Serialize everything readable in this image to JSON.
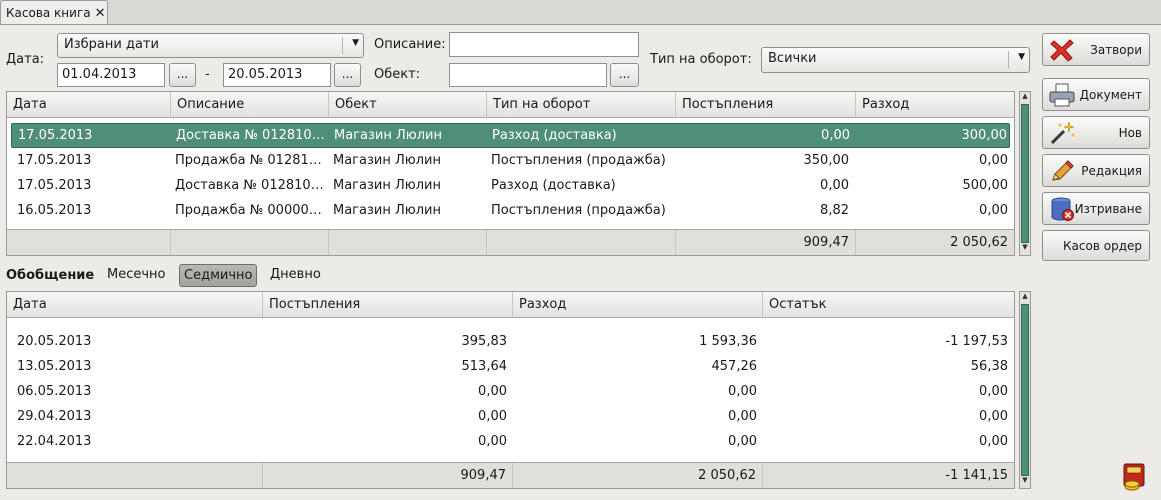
{
  "tab": {
    "title": "Касова книга",
    "close_glyph": "✕"
  },
  "filters": {
    "date_label": "Дата:",
    "date_mode": "Избрани дати",
    "date_from": "01.04.2013",
    "date_to": "20.05.2013",
    "dash": "-",
    "ellipsis": "...",
    "description_label": "Описание:",
    "description_value": "",
    "object_label": "Обект:",
    "object_value": "",
    "turnover_label": "Тип на оборот:",
    "turnover_value": "Всички"
  },
  "main_table": {
    "columns": [
      "Дата",
      "Описание",
      "Обект",
      "Тип на оборот",
      "Постъпления",
      "Разход"
    ],
    "rows": [
      {
        "date": "17.05.2013",
        "description": "Доставка № 012810…",
        "object": "Магазин Люлин",
        "type": "Разход (доставка)",
        "income": "0,00",
        "expense": "300,00"
      },
      {
        "date": "17.05.2013",
        "description": "Продажба № 01281…",
        "object": "Магазин Люлин",
        "type": "Постъпления (продажба)",
        "income": "350,00",
        "expense": "0,00"
      },
      {
        "date": "17.05.2013",
        "description": "Доставка № 012810…",
        "object": "Магазин Люлин",
        "type": "Разход (доставка)",
        "income": "0,00",
        "expense": "500,00"
      },
      {
        "date": "16.05.2013",
        "description": "Продажба № 00000…",
        "object": "Магазин Люлин",
        "type": "Постъпления (продажба)",
        "income": "8,82",
        "expense": "0,00"
      }
    ],
    "totals": {
      "income": "909,47",
      "expense": "2 050,62"
    }
  },
  "summary": {
    "title": "Обобщение",
    "modes": [
      "Месечно",
      "Седмично",
      "Дневно"
    ],
    "active_mode": "Седмично",
    "columns": [
      "Дата",
      "Постъпления",
      "Разход",
      "Остатък"
    ],
    "rows": [
      {
        "date": "20.05.2013",
        "income": "395,83",
        "expense": "1 593,36",
        "balance": "-1 197,53"
      },
      {
        "date": "13.05.2013",
        "income": "513,64",
        "expense": "457,26",
        "balance": "56,38"
      },
      {
        "date": "06.05.2013",
        "income": "0,00",
        "expense": "0,00",
        "balance": "0,00"
      },
      {
        "date": "29.04.2013",
        "income": "0,00",
        "expense": "0,00",
        "balance": "0,00"
      },
      {
        "date": "22.04.2013",
        "income": "0,00",
        "expense": "0,00",
        "balance": "0,00"
      }
    ],
    "totals": {
      "income": "909,47",
      "expense": "2 050,62",
      "balance": "-1 141,15"
    }
  },
  "actions": {
    "close": "Затвори",
    "document": "Документ",
    "new": "Нов",
    "edit": "Редакция",
    "delete": "Изтриване",
    "cash_order": "Касов ордер"
  },
  "colors": {
    "selection": "#4f8f78",
    "panel": "#ecebe8",
    "close_icon": "#e0302a"
  },
  "icons": [
    "close-icon",
    "printer-icon",
    "magic-wand-icon",
    "pencil-icon",
    "database-delete-icon",
    "cash-register-icon"
  ]
}
